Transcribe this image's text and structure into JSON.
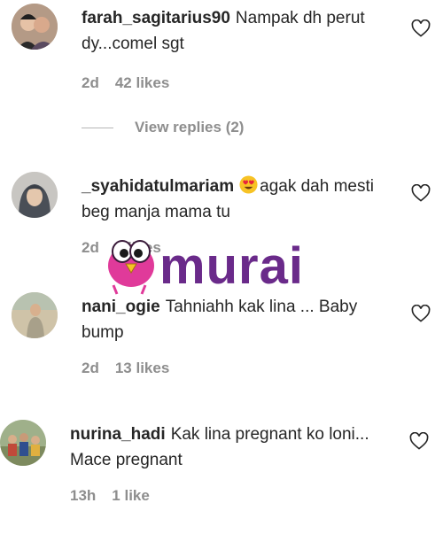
{
  "comments": [
    {
      "username": "farah_sagitarius90",
      "text": "Nampak dh perut dy...comel sgt",
      "age": "2d",
      "likes": "42 likes",
      "view_replies": "View replies (2)"
    },
    {
      "username": "_syahidatulmariam",
      "emoji": "heart-eyes-emoji",
      "text": "agak dah mesti beg manja mama tu",
      "age": "2d",
      "likes": "5 likes"
    },
    {
      "username": "nani_ogie",
      "text": "Tahniahh kak lina ... Baby bump",
      "age": "2d",
      "likes": "13 likes"
    },
    {
      "username": "nurina_hadi",
      "text": "Kak lina pregnant ko loni... Mace pregnant",
      "age": "13h",
      "likes": "1 like"
    }
  ],
  "watermark": {
    "brand": "murai",
    "color": "#6a2a8a",
    "bird_color": "#e03a9a"
  },
  "colors": {
    "text": "#262626",
    "meta": "#8e8e8e"
  },
  "icons": {
    "like": "heart-outline-icon"
  }
}
